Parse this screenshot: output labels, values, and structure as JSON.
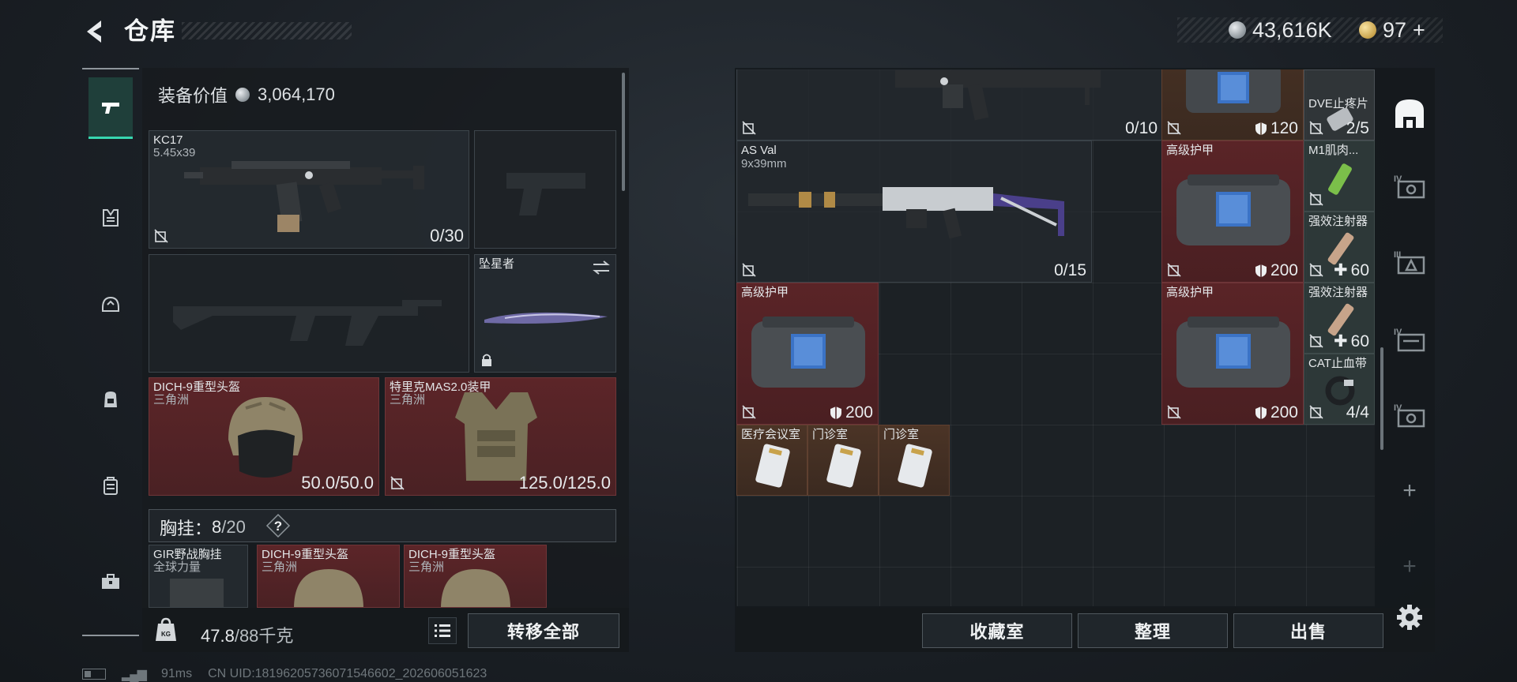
{
  "header": {
    "title": "仓库",
    "currencies": [
      {
        "icon": "silver-coin-icon",
        "value": "43,616K"
      },
      {
        "icon": "gold-coin-icon",
        "value": "97"
      }
    ],
    "gold_add": "+"
  },
  "left_nav": {
    "items": [
      {
        "icon": "pistol-icon",
        "active": true
      },
      {
        "icon": "armor-vest-icon",
        "active": false
      },
      {
        "icon": "helmet-icon",
        "active": false
      },
      {
        "icon": "backpack-icon",
        "active": false
      },
      {
        "icon": "case-icon",
        "active": false
      },
      {
        "icon": "toolbox-icon",
        "active": false
      }
    ]
  },
  "equipment": {
    "value_label": "装备价值",
    "value": "3,064,170",
    "primary": {
      "name": "KC17",
      "caliber": "5.45x39",
      "ammo": "0/30"
    },
    "melee": {
      "name": "坠星者"
    },
    "helmet": {
      "name": "DICH-9重型头盔",
      "sub": "三角洲",
      "durability": "50.0/50.0"
    },
    "armor": {
      "name": "特里克MAS2.0装甲",
      "sub": "三角洲",
      "durability": "125.0/125.0"
    },
    "chest_rig": {
      "label": "胸挂：",
      "used": "8",
      "capacity": "/20",
      "help": "?"
    },
    "rig_items": [
      {
        "name": "GIR野战胸挂",
        "sub": "全球力量"
      },
      {
        "name": "DICH-9重型头盔",
        "sub": "三角洲"
      },
      {
        "name": "DICH-9重型头盔",
        "sub": "三角洲"
      }
    ],
    "weight": "47.8",
    "weight_max": "/88千克",
    "transfer_all": "转移全部"
  },
  "stash": {
    "items": [
      {
        "id": "rifle-top",
        "count": "0/10"
      },
      {
        "id": "armor-top",
        "count": "120"
      },
      {
        "id": "dve",
        "name": "DVE止疼片",
        "count": "2/5"
      },
      {
        "id": "asval",
        "name": "AS Val",
        "sub": "9x39mm",
        "count": "0/15"
      },
      {
        "id": "armor-r1",
        "name": "高级护甲",
        "count": "200"
      },
      {
        "id": "m1",
        "name": "M1肌肉..."
      },
      {
        "id": "inj1",
        "name": "强效注射器",
        "count": "60"
      },
      {
        "id": "armor-l",
        "name": "高级护甲",
        "count": "200"
      },
      {
        "id": "armor-r2",
        "name": "高级护甲",
        "count": "200"
      },
      {
        "id": "inj2",
        "name": "强效注射器",
        "count": "60"
      },
      {
        "id": "cat",
        "name": "CAT止血带",
        "count": "4/4"
      },
      {
        "id": "key1",
        "name": "医疗会议室"
      },
      {
        "id": "key2",
        "name": "门诊室"
      },
      {
        "id": "key3",
        "name": "门诊室"
      }
    ],
    "buttons": {
      "collection": "收藏室",
      "sort": "整理",
      "sell": "出售"
    }
  },
  "right_nav": {
    "items": [
      "case-icon",
      "storage-tier-iv-icon",
      "storage-tier-iii-icon",
      "storage-tier-iv-icon",
      "storage-tier-iv-icon"
    ],
    "add": "+"
  },
  "status": {
    "ping": "91ms",
    "uid": "CN UID:18196205736071546602_202606051623"
  },
  "colors": {
    "accent": "#37d6b0",
    "red_rarity": "#5a2427",
    "orange_rarity": "#4b3426"
  }
}
